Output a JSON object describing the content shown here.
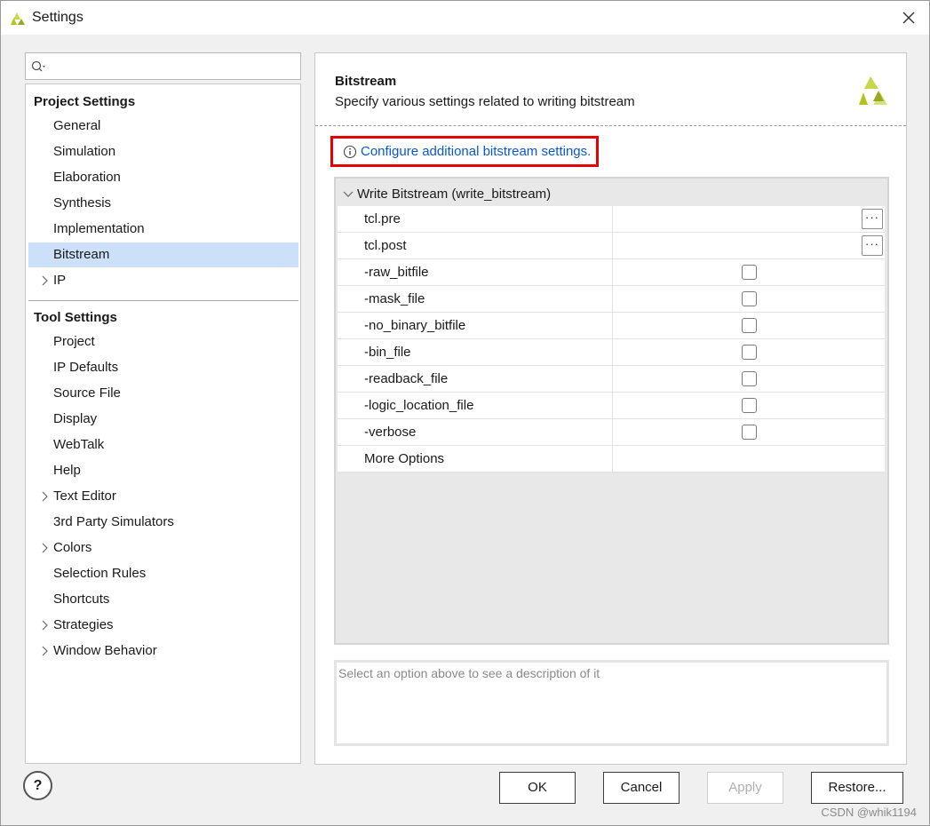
{
  "window": {
    "title": "Settings",
    "close_glyph": "✕"
  },
  "search": {
    "placeholder": ""
  },
  "tree": {
    "project_header": "Project Settings",
    "project_items": [
      {
        "label": "General",
        "expandable": false,
        "selected": false
      },
      {
        "label": "Simulation",
        "expandable": false,
        "selected": false
      },
      {
        "label": "Elaboration",
        "expandable": false,
        "selected": false
      },
      {
        "label": "Synthesis",
        "expandable": false,
        "selected": false
      },
      {
        "label": "Implementation",
        "expandable": false,
        "selected": false
      },
      {
        "label": "Bitstream",
        "expandable": false,
        "selected": true
      },
      {
        "label": "IP",
        "expandable": true,
        "selected": false
      }
    ],
    "tool_header": "Tool Settings",
    "tool_items": [
      {
        "label": "Project",
        "expandable": false
      },
      {
        "label": "IP Defaults",
        "expandable": false
      },
      {
        "label": "Source File",
        "expandable": false
      },
      {
        "label": "Display",
        "expandable": false
      },
      {
        "label": "WebTalk",
        "expandable": false
      },
      {
        "label": "Help",
        "expandable": false
      },
      {
        "label": "Text Editor",
        "expandable": true
      },
      {
        "label": "3rd Party Simulators",
        "expandable": false
      },
      {
        "label": "Colors",
        "expandable": true
      },
      {
        "label": "Selection Rules",
        "expandable": false
      },
      {
        "label": "Shortcuts",
        "expandable": false
      },
      {
        "label": "Strategies",
        "expandable": true
      },
      {
        "label": "Window Behavior",
        "expandable": true
      }
    ]
  },
  "panel": {
    "title": "Bitstream",
    "subtitle": "Specify various settings related to writing bitstream",
    "configure_link": "Configure additional bitstream settings.",
    "group_label": "Write Bitstream (write_bitstream)",
    "rows": [
      {
        "name": "tcl.pre",
        "kind": "file",
        "button": "···"
      },
      {
        "name": "tcl.post",
        "kind": "file",
        "button": "···"
      },
      {
        "name": "-raw_bitfile",
        "kind": "checkbox",
        "checked": false
      },
      {
        "name": "-mask_file",
        "kind": "checkbox",
        "checked": false
      },
      {
        "name": "-no_binary_bitfile",
        "kind": "checkbox",
        "checked": false
      },
      {
        "name": "-bin_file",
        "kind": "checkbox",
        "checked": false
      },
      {
        "name": "-readback_file",
        "kind": "checkbox",
        "checked": false
      },
      {
        "name": "-logic_location_file",
        "kind": "checkbox",
        "checked": false
      },
      {
        "name": "-verbose",
        "kind": "checkbox",
        "checked": false
      },
      {
        "name": "More Options",
        "kind": "text",
        "value": ""
      }
    ],
    "description_placeholder": "Select an option above to see a description of it"
  },
  "footer": {
    "help_label": "?",
    "ok_label": "OK",
    "cancel_label": "Cancel",
    "apply_label": "Apply",
    "restore_label": "Restore..."
  },
  "watermark": "CSDN @whik1194",
  "colors": {
    "accent_link": "#0b57d0",
    "selection": "#cce0fa",
    "highlight_box": "#e60000",
    "xilinx_logo": "#b5c31f"
  }
}
